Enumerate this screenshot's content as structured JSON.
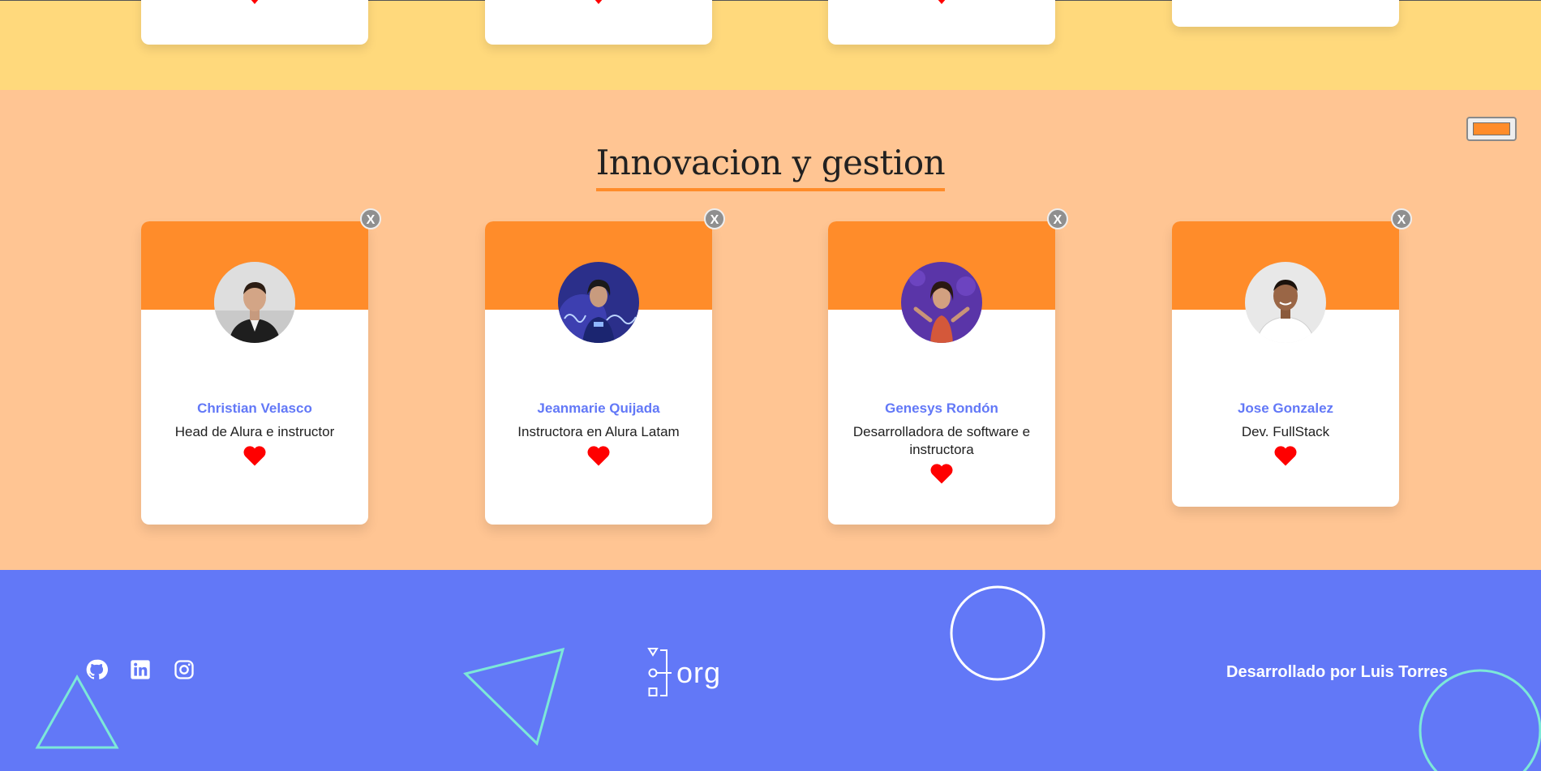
{
  "colors": {
    "previous_section_bg": "#FFD97C",
    "team_bg": "#FFC593",
    "team_accent": "#FF8C2A",
    "name_color": "#6278F7",
    "footer_bg": "#6278F7",
    "heart": "#FF0000"
  },
  "team": {
    "title": "Innovacion y gestion",
    "toggle_icon": "color-swatch-icon",
    "members": [
      {
        "name": "Christian Velasco",
        "role": "Head de Alura e instructor",
        "favorite": true,
        "delete_label": "X"
      },
      {
        "name": "Jeanmarie Quijada",
        "role": "Instructora en Alura Latam",
        "favorite": true,
        "delete_label": "X"
      },
      {
        "name": "Genesys Rondón",
        "role": "Desarrolladora de software e instructora",
        "favorite": true,
        "delete_label": "X"
      },
      {
        "name": "Jose Gonzalez",
        "role": "Dev. FullStack",
        "favorite": true,
        "delete_label": "X"
      }
    ]
  },
  "footer": {
    "social": [
      "github-icon",
      "linkedin-icon",
      "instagram-icon"
    ],
    "logo_text": "org",
    "credit": "Desarrollado por Luis Torres"
  }
}
